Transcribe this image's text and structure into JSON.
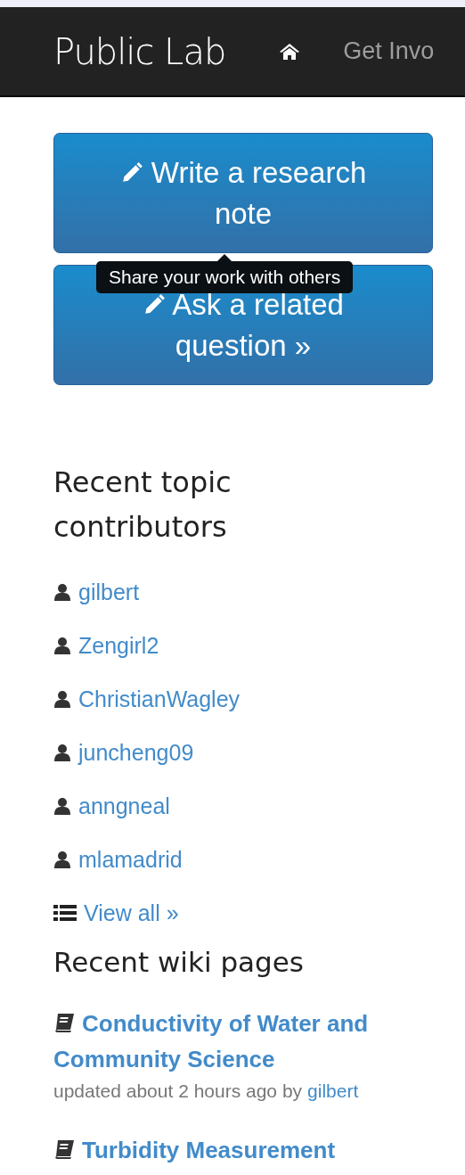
{
  "navbar": {
    "brand": "Public Lab",
    "links": [
      "Get Invo"
    ]
  },
  "actions": [
    {
      "label": "Write a research note",
      "tooltip": "Share your work with others"
    },
    {
      "label": "Ask a related question »"
    }
  ],
  "contributors": {
    "title": "Recent topic contributors",
    "users": [
      "gilbert",
      "Zengirl2",
      "ChristianWagley",
      "juncheng09",
      "anngneal",
      "mlamadrid"
    ],
    "view_all": "View all »"
  },
  "wiki": {
    "title": "Recent wiki pages",
    "pages": [
      {
        "title": "Conductivity of Water and Community Science",
        "updated": "updated about 2 hours ago by",
        "author": "gilbert"
      },
      {
        "title": "Turbidity Measurement"
      }
    ]
  }
}
